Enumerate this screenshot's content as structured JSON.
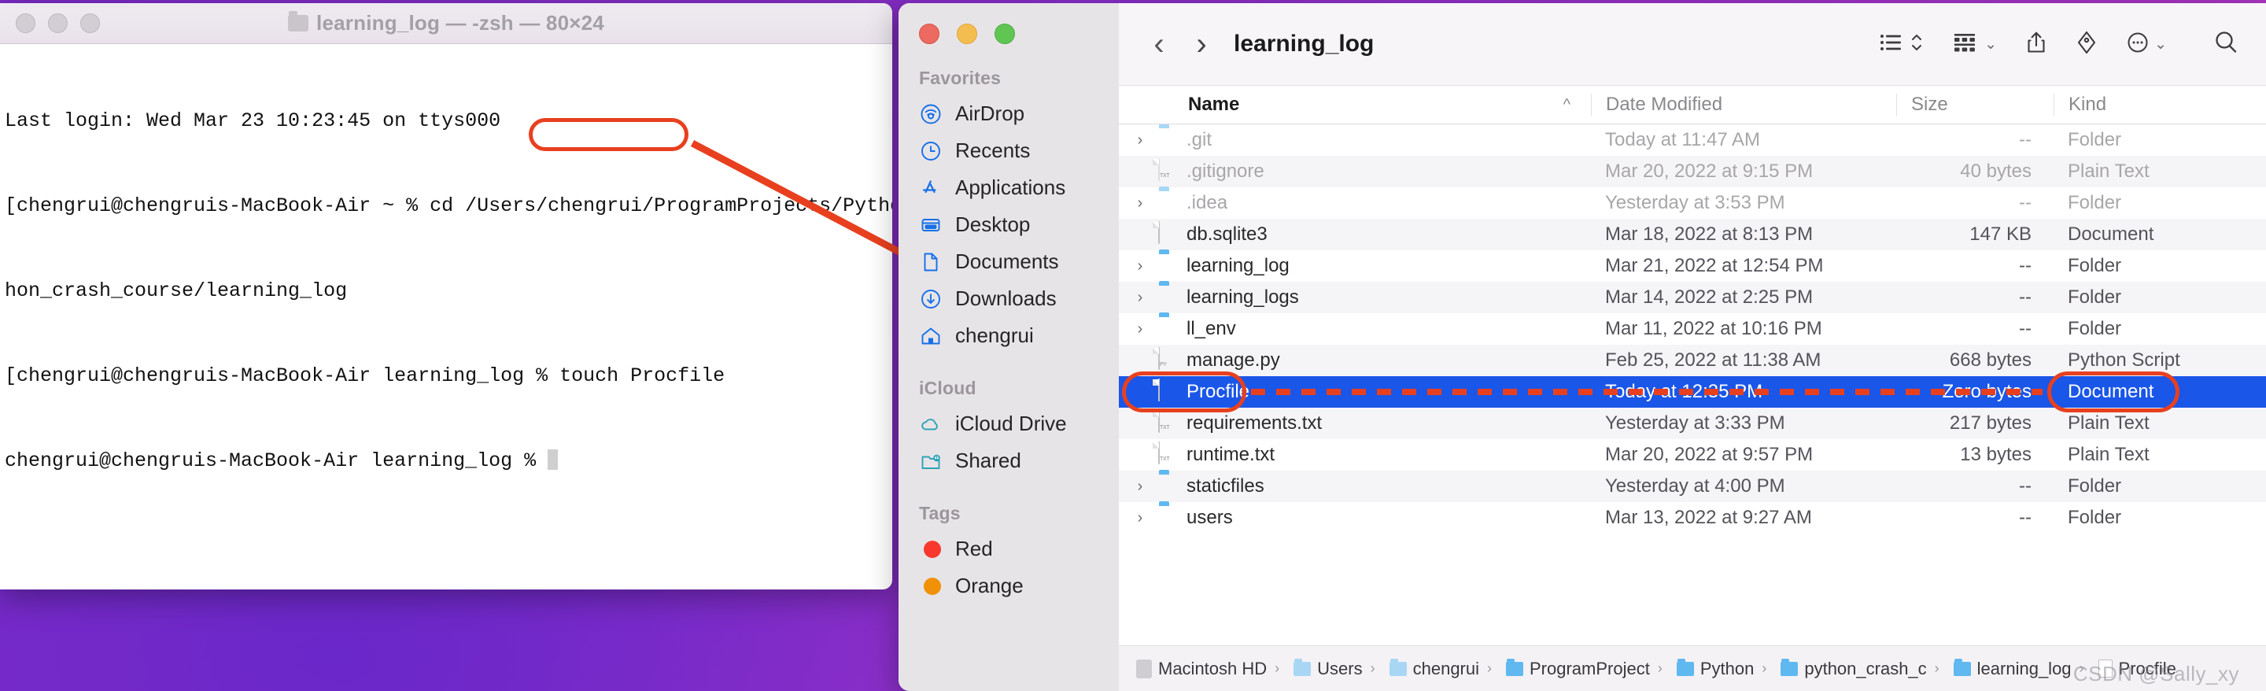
{
  "desktop": {
    "bg_colors": [
      "#7a2bc4",
      "#a834c6",
      "#c04ab8"
    ]
  },
  "terminal": {
    "title": "learning_log — -zsh — 80×24",
    "folder_icon": "folder-icon",
    "traffic_lights": [
      "close-button",
      "minimize-button",
      "zoom-button"
    ],
    "lines": [
      "Last login: Wed Mar 23 10:23:45 on ttys000",
      "[chengrui@chengruis-MacBook-Air ~ % cd /Users/chengrui/ProgramProjects/Python/pyt]",
      "hon_crash_course/learning_log",
      "[chengrui@chengruis-MacBook-Air learning_log % touch Procfile                     ]",
      "chengrui@chengruis-MacBook-Air learning_log % "
    ],
    "highlighted_command": "touch Procfile"
  },
  "annotation": {
    "accent_color": "#e8401f",
    "callout_command": "touch Procfile",
    "callout_target": "Procfile"
  },
  "finder": {
    "traffic_lights": [
      "close-button",
      "minimize-button",
      "zoom-button"
    ],
    "toolbar": {
      "back_label": "‹",
      "forward_label": "›",
      "title": "learning_log",
      "buttons": [
        {
          "name": "view-list-button",
          "label": "list-view-icon"
        },
        {
          "name": "group-by-button",
          "label": "group-icon"
        },
        {
          "name": "share-button",
          "label": "share-icon"
        },
        {
          "name": "tag-button",
          "label": "tag-icon"
        },
        {
          "name": "more-button",
          "label": "more-ellipsis-icon"
        },
        {
          "name": "search-button",
          "label": "search-icon"
        }
      ]
    },
    "sidebar": {
      "sections": [
        {
          "title": "Favorites",
          "items": [
            {
              "label": "AirDrop",
              "icon": "airdrop-icon"
            },
            {
              "label": "Recents",
              "icon": "clock-icon"
            },
            {
              "label": "Applications",
              "icon": "appstore-icon"
            },
            {
              "label": "Desktop",
              "icon": "desktop-icon"
            },
            {
              "label": "Documents",
              "icon": "document-icon"
            },
            {
              "label": "Downloads",
              "icon": "download-icon"
            },
            {
              "label": "chengrui",
              "icon": "home-icon"
            }
          ]
        },
        {
          "title": "iCloud",
          "items": [
            {
              "label": "iCloud Drive",
              "icon": "cloud-icon"
            },
            {
              "label": "Shared",
              "icon": "shared-folder-icon"
            }
          ]
        },
        {
          "title": "Tags",
          "items": [
            {
              "label": "Red",
              "icon": "tag-dot-icon",
              "color": "#f8382e"
            },
            {
              "label": "Orange",
              "icon": "tag-dot-icon",
              "color": "#f09108"
            }
          ]
        }
      ]
    },
    "columns": {
      "name": "Name",
      "sort_arrow": "^",
      "date_modified": "Date Modified",
      "size": "Size",
      "kind": "Kind"
    },
    "files": [
      {
        "name": ".git",
        "date": "Today at 11:47 AM",
        "size": "--",
        "kind": "Folder",
        "icon": "folder-icon",
        "expandable": true,
        "dim": true,
        "selected": false
      },
      {
        "name": ".gitignore",
        "date": "Mar 20, 2022 at 9:15 PM",
        "size": "40 bytes",
        "kind": "Plain Text",
        "icon": "txt-file-icon",
        "expandable": false,
        "dim": true,
        "selected": false
      },
      {
        "name": ".idea",
        "date": "Yesterday at 3:53 PM",
        "size": "--",
        "kind": "Folder",
        "icon": "folder-icon",
        "expandable": true,
        "dim": true,
        "selected": false
      },
      {
        "name": "db.sqlite3",
        "date": "Mar 18, 2022 at 8:13 PM",
        "size": "147 KB",
        "kind": "Document",
        "icon": "doc-file-icon",
        "expandable": false,
        "dim": false,
        "selected": false
      },
      {
        "name": "learning_log",
        "date": "Mar 21, 2022 at 12:54 PM",
        "size": "--",
        "kind": "Folder",
        "icon": "folder-icon",
        "expandable": true,
        "dim": false,
        "selected": false
      },
      {
        "name": "learning_logs",
        "date": "Mar 14, 2022 at 2:25 PM",
        "size": "--",
        "kind": "Folder",
        "icon": "folder-icon",
        "expandable": true,
        "dim": false,
        "selected": false
      },
      {
        "name": "ll_env",
        "date": "Mar 11, 2022 at 10:16 PM",
        "size": "--",
        "kind": "Folder",
        "icon": "folder-icon",
        "expandable": true,
        "dim": false,
        "selected": false
      },
      {
        "name": "manage.py",
        "date": "Feb 25, 2022 at 11:38 AM",
        "size": "668 bytes",
        "kind": "Python Script",
        "icon": "py-file-icon",
        "expandable": false,
        "dim": false,
        "selected": false
      },
      {
        "name": "Procfile",
        "date": "Today at 12:35 PM",
        "size": "Zero bytes",
        "kind": "Document",
        "icon": "doc-file-icon",
        "expandable": false,
        "dim": false,
        "selected": true
      },
      {
        "name": "requirements.txt",
        "date": "Yesterday at 3:33 PM",
        "size": "217 bytes",
        "kind": "Plain Text",
        "icon": "txt-file-icon",
        "expandable": false,
        "dim": false,
        "selected": false
      },
      {
        "name": "runtime.txt",
        "date": "Mar 20, 2022 at 9:57 PM",
        "size": "13 bytes",
        "kind": "Plain Text",
        "icon": "txt-file-icon",
        "expandable": false,
        "dim": false,
        "selected": false
      },
      {
        "name": "staticfiles",
        "date": "Yesterday at 4:00 PM",
        "size": "--",
        "kind": "Folder",
        "icon": "folder-icon",
        "expandable": true,
        "dim": false,
        "selected": false
      },
      {
        "name": "users",
        "date": "Mar 13, 2022 at 9:27 AM",
        "size": "--",
        "kind": "Folder",
        "icon": "folder-icon",
        "expandable": true,
        "dim": false,
        "selected": false
      }
    ],
    "path_bar": [
      {
        "label": "Macintosh HD",
        "icon": "harddisk-icon"
      },
      {
        "label": "Users",
        "icon": "users-folder-icon"
      },
      {
        "label": "chengrui",
        "icon": "home-folder-icon"
      },
      {
        "label": "ProgramProject",
        "icon": "folder-icon"
      },
      {
        "label": "Python",
        "icon": "folder-icon"
      },
      {
        "label": "python_crash_c",
        "icon": "folder-icon"
      },
      {
        "label": "learning_log",
        "icon": "folder-icon"
      },
      {
        "label": "Procfile",
        "icon": "doc-file-icon"
      }
    ]
  },
  "watermark": "CSDN @Sally_xy"
}
